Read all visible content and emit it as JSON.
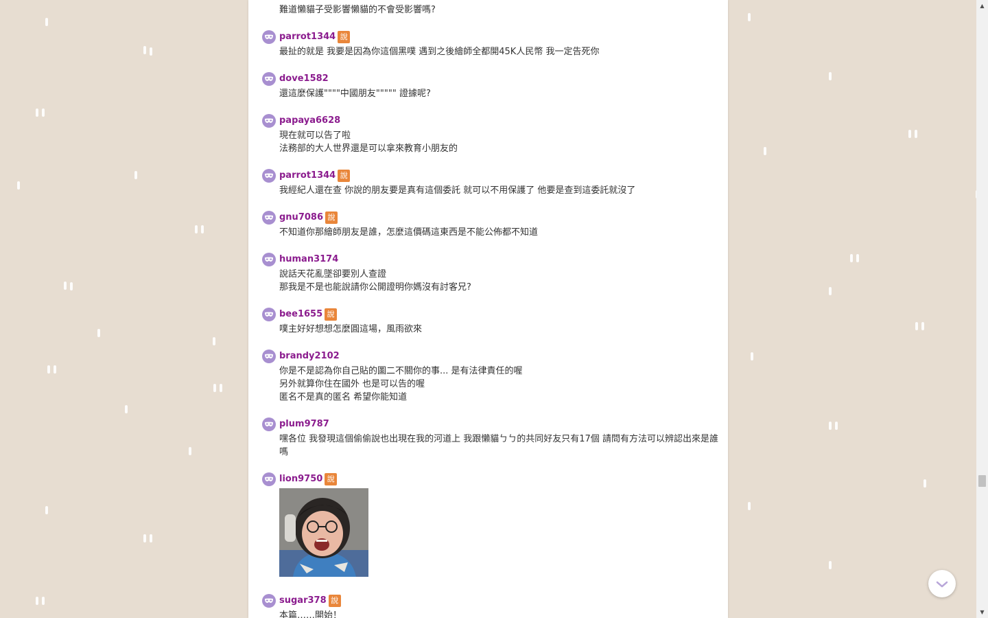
{
  "colors": {
    "page_bg": "#e7ddd1",
    "username": "#8b1c8e",
    "badge": "#e9863a",
    "avatar": "#a88fd0"
  },
  "badge_label": "說",
  "top_partial_text": "難道懶貓子受影響懶貓的不會受影響嗎?",
  "comments": [
    {
      "user": "parrot1344",
      "badge": true,
      "lines": [
        "最扯的就是 我要是因為你這個黑噗 遇到之後繪師全都開45K人民幣 我一定告死你"
      ]
    },
    {
      "user": "dove1582",
      "badge": false,
      "lines": [
        "還這麼保護\"\"\"\"中國朋友\"\"\"\"\" 證據呢?"
      ]
    },
    {
      "user": "papaya6628",
      "badge": false,
      "lines": [
        "現在就可以告了啦",
        "法務部的大人世界還是可以拿來教育小朋友的"
      ]
    },
    {
      "user": "parrot1344",
      "badge": true,
      "lines": [
        "我經紀人還在查 你說的朋友要是真有這個委託 就可以不用保護了 他要是查到這委託就沒了"
      ]
    },
    {
      "user": "gnu7086",
      "badge": true,
      "lines": [
        "不知道你那繪師朋友是誰，怎麼這價碼這東西是不能公佈都不知道"
      ]
    },
    {
      "user": "human3174",
      "badge": false,
      "lines": [
        "說話天花亂墜卻要別人查證",
        "那我是不是也能說請你公開證明你媽沒有討客兄?"
      ]
    },
    {
      "user": "bee1655",
      "badge": true,
      "lines": [
        "噗主好好想想怎麼圓這場，風雨欲來"
      ]
    },
    {
      "user": "brandy2102",
      "badge": false,
      "lines": [
        "你是不是認為你自己貼的圖二不關你的事... 是有法律責任的喔",
        "另外就算你住在國外 也是可以告的喔",
        "匿名不是真的匿名 希望你能知道"
      ]
    },
    {
      "user": "plum9787",
      "badge": false,
      "lines": [
        "嘿各位 我發現這個偷偷說也出現在我的河道上 我跟懶貓ㄅㄅ的共同好友只有17個 請問有方法可以辨認出來是誰嗎"
      ]
    },
    {
      "user": "lion9750",
      "badge": true,
      "lines": []
    },
    {
      "user": "sugar378",
      "badge": true,
      "lines": [
        "本篇……開始！"
      ]
    }
  ],
  "icons": {
    "avatar": "mask-icon",
    "scroll_down": "chevron-down-icon"
  }
}
